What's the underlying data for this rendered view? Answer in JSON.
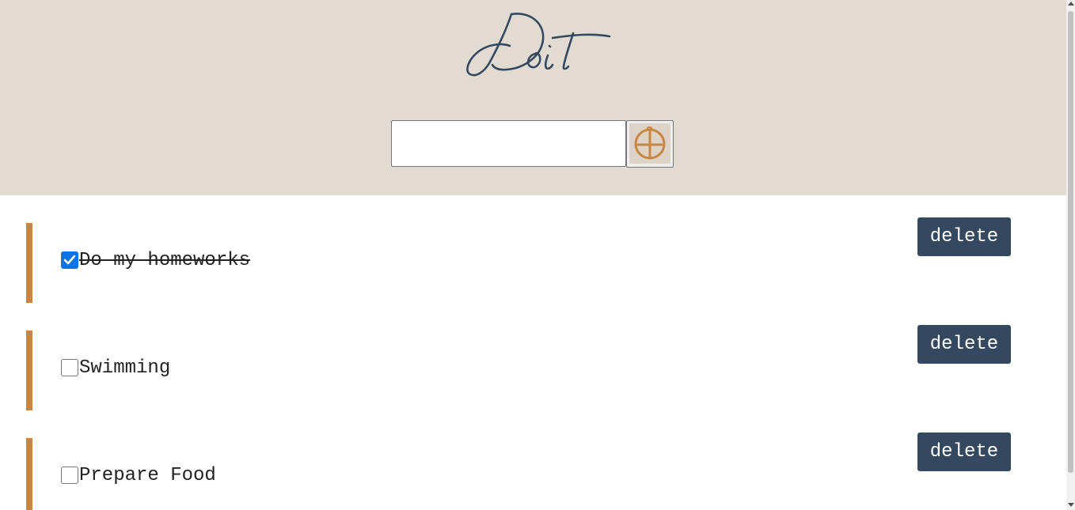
{
  "header": {
    "logo_text": "Doit",
    "input": {
      "value": "",
      "placeholder": ""
    },
    "add_button": {
      "icon": "plus-circle-icon"
    }
  },
  "todos": [
    {
      "text": "Do my homeworks",
      "checked": true,
      "delete_label": "delete"
    },
    {
      "text": "Swimming",
      "checked": false,
      "delete_label": "delete"
    },
    {
      "text": "Prepare Food",
      "checked": false,
      "delete_label": "delete"
    }
  ],
  "colors": {
    "header_background": "#e2dbd1",
    "accent_bar": "#c98642",
    "delete_button": "#34495f",
    "logo": "#34495f",
    "add_icon": "#c98642",
    "checkbox_checked": "#0b74e5"
  }
}
